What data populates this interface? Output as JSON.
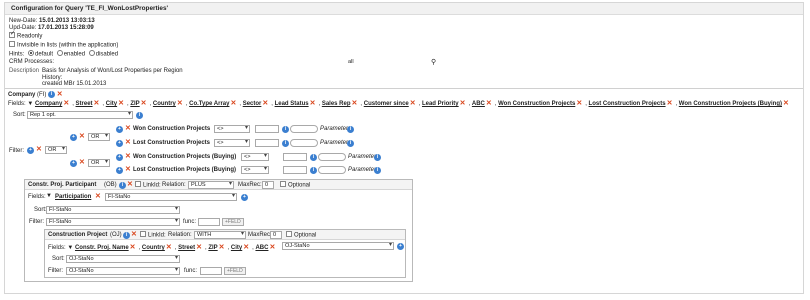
{
  "window": {
    "title": "Configuration for Query 'TE_FI_WonLostProperties'"
  },
  "meta": {
    "new_date_label": "New-Date:",
    "new_date_value": "15.01.2013 13:03:13",
    "upd_date_label": "Upd-Date:",
    "upd_date_value": "17.01.2013 15:28:09",
    "readonly_label": "Readonly",
    "readonly_checked": true,
    "invisible_label": "Invisible in lists (within the application)",
    "invisible_checked": false,
    "hints_label": "Hints:",
    "hints_options": [
      "default",
      "enabled",
      "disabled"
    ],
    "hints_selected": "default",
    "crm_label": "CRM Processes:",
    "crm_value": "all",
    "description_label": "Description",
    "description_lines": [
      "Basis for Analysis of Won/Lost Properties per Region",
      "History:",
      "created MBr 15.01.2013"
    ]
  },
  "company": {
    "header": "Company",
    "header_code": "(FI)",
    "fields_label": "Fields:",
    "fields": [
      "Company",
      "Street",
      "City",
      "ZIP",
      "Country",
      "Co.Type Array",
      "Sector",
      "Lead Status",
      "Sales Rep",
      "Customer since",
      "Lead Priority",
      "ABC",
      "Won Construction Projects",
      "Lost Construction Projects",
      "Won Construction Projects (Buying)"
    ],
    "sort_label": "Sort:",
    "sort_value": "Rep 1 opt.",
    "filter_label": "Filter:",
    "filter_root_op": "OR",
    "filter_groups": [
      {
        "op": "OR",
        "conditions": [
          {
            "field": "Won Construction Projects",
            "operator": "<>",
            "value": "",
            "param": "Parameter"
          },
          {
            "field": "Lost Construction Projects",
            "operator": "<>",
            "value": "",
            "param": "Parameter"
          }
        ]
      },
      {
        "op": "OR",
        "conditions": [
          {
            "field": "Won Construction Projects (Buying)",
            "operator": "<>",
            "value": "",
            "param": "Parameter"
          },
          {
            "field": "Lost Construction Projects (Buying)",
            "operator": "<>",
            "value": "",
            "param": "Parameter"
          }
        ]
      }
    ]
  },
  "participant": {
    "header": "Constr. Proj. Participant",
    "header_code": "(OB)",
    "linkid_label": "LinkId:",
    "relation_label": "Relation:",
    "relation_value": "PLUS",
    "maxrec_label": "MaxRec:",
    "maxrec_value": "0",
    "optional_label": "Optional",
    "fields_label": "Fields:",
    "field": "Participation",
    "field_select": "FI-StaNo",
    "sort_label": "Sort:",
    "sort_value": "FI-StaNo",
    "filter_label": "Filter:",
    "filter_value": "FI-StaNo",
    "func_label": "func:",
    "func_btn": "+FELD"
  },
  "project": {
    "header": "Construction Project",
    "header_code": "(OJ)",
    "linkid_label": "LinkId:",
    "relation_label": "Relation:",
    "relation_value": "WITH",
    "maxrec_label": "MaxRec:",
    "maxrec_value": "0",
    "optional_label": "Optional",
    "fields_label": "Fields:",
    "fields": [
      "Constr. Proj. Name",
      "Country",
      "Street",
      "ZIP",
      "City",
      "ABC"
    ],
    "field_select": "OJ-StaNo",
    "sort_label": "Sort:",
    "sort_value": "OJ-StaNo",
    "filter_label": "Filter:",
    "filter_value": "OJ-StaNo",
    "func_label": "func:",
    "func_btn": "+FELD"
  },
  "colors": {
    "accent_blue": "#3b7fd0",
    "delete_red": "#d9441a"
  }
}
